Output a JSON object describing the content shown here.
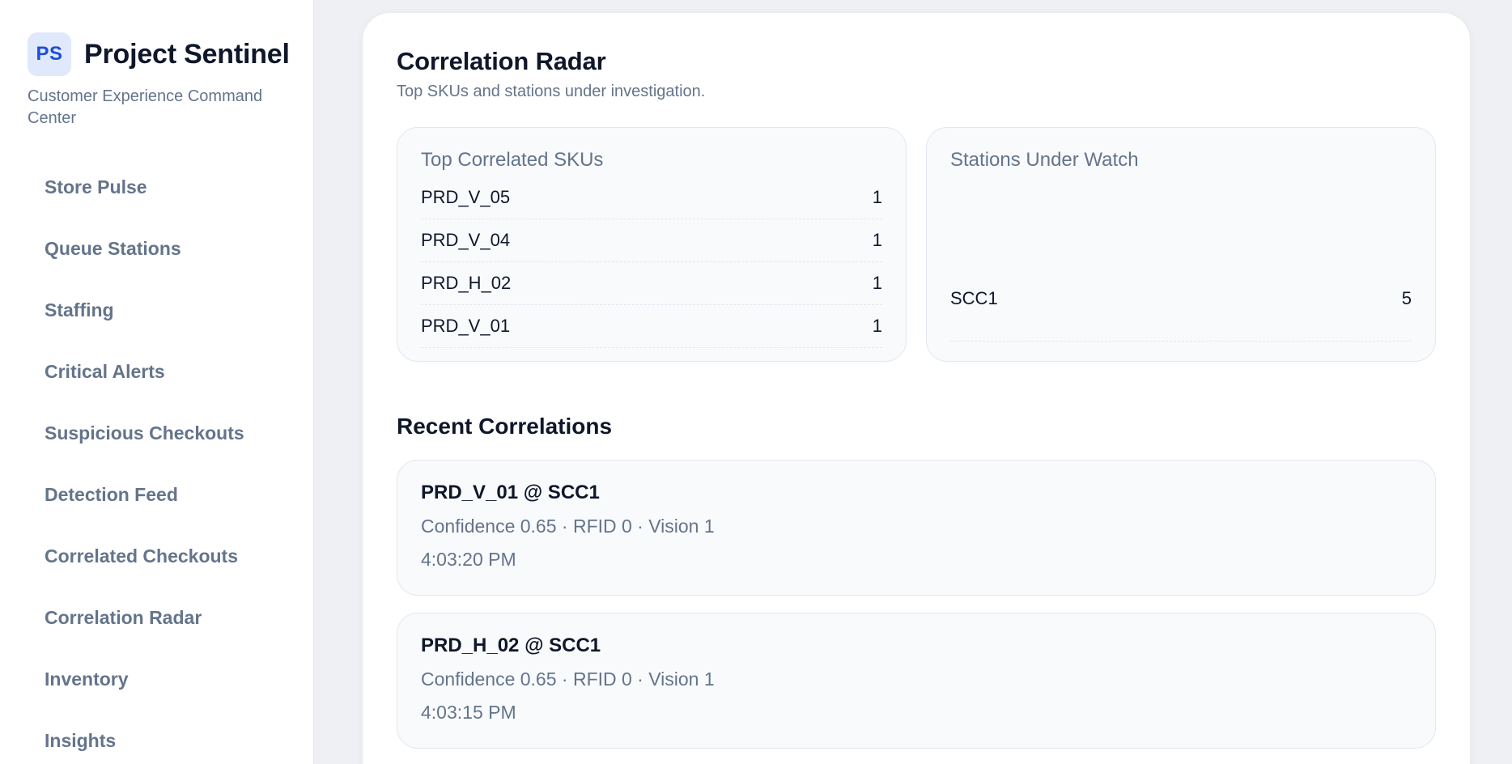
{
  "brand": {
    "logo": "PS",
    "name": "Project Sentinel",
    "subtitle": "Customer Experience Command Center"
  },
  "sidebar": {
    "items": [
      {
        "label": "Store Pulse"
      },
      {
        "label": "Queue Stations"
      },
      {
        "label": "Staffing"
      },
      {
        "label": "Critical Alerts"
      },
      {
        "label": "Suspicious Checkouts"
      },
      {
        "label": "Detection Feed"
      },
      {
        "label": "Correlated Checkouts"
      },
      {
        "label": "Correlation Radar"
      },
      {
        "label": "Inventory"
      },
      {
        "label": "Insights"
      }
    ]
  },
  "main": {
    "title": "Correlation Radar",
    "subtitle": "Top SKUs and stations under investigation.",
    "sku_card": {
      "title": "Top Correlated SKUs",
      "rows": [
        {
          "name": "PRD_V_05",
          "count": "1"
        },
        {
          "name": "PRD_V_04",
          "count": "1"
        },
        {
          "name": "PRD_H_02",
          "count": "1"
        },
        {
          "name": "PRD_V_01",
          "count": "1"
        }
      ]
    },
    "station_card": {
      "title": "Stations Under Watch",
      "rows": [
        {
          "name": "SCC1",
          "count": "5"
        }
      ]
    },
    "recent": {
      "title": "Recent Correlations",
      "items": [
        {
          "title": "PRD_V_01 @ SCC1",
          "meta": "Confidence 0.65 · RFID 0 · Vision 1",
          "time": "4:03:20 PM"
        },
        {
          "title": "PRD_H_02 @ SCC1",
          "meta": "Confidence 0.65 · RFID 0 · Vision 1",
          "time": "4:03:15 PM"
        }
      ]
    }
  },
  "colors": {
    "accent": "#1d4ed8",
    "logo_bg": "#e0e9fb",
    "muted_text": "#64748b",
    "page_bg": "#eef0f4"
  }
}
